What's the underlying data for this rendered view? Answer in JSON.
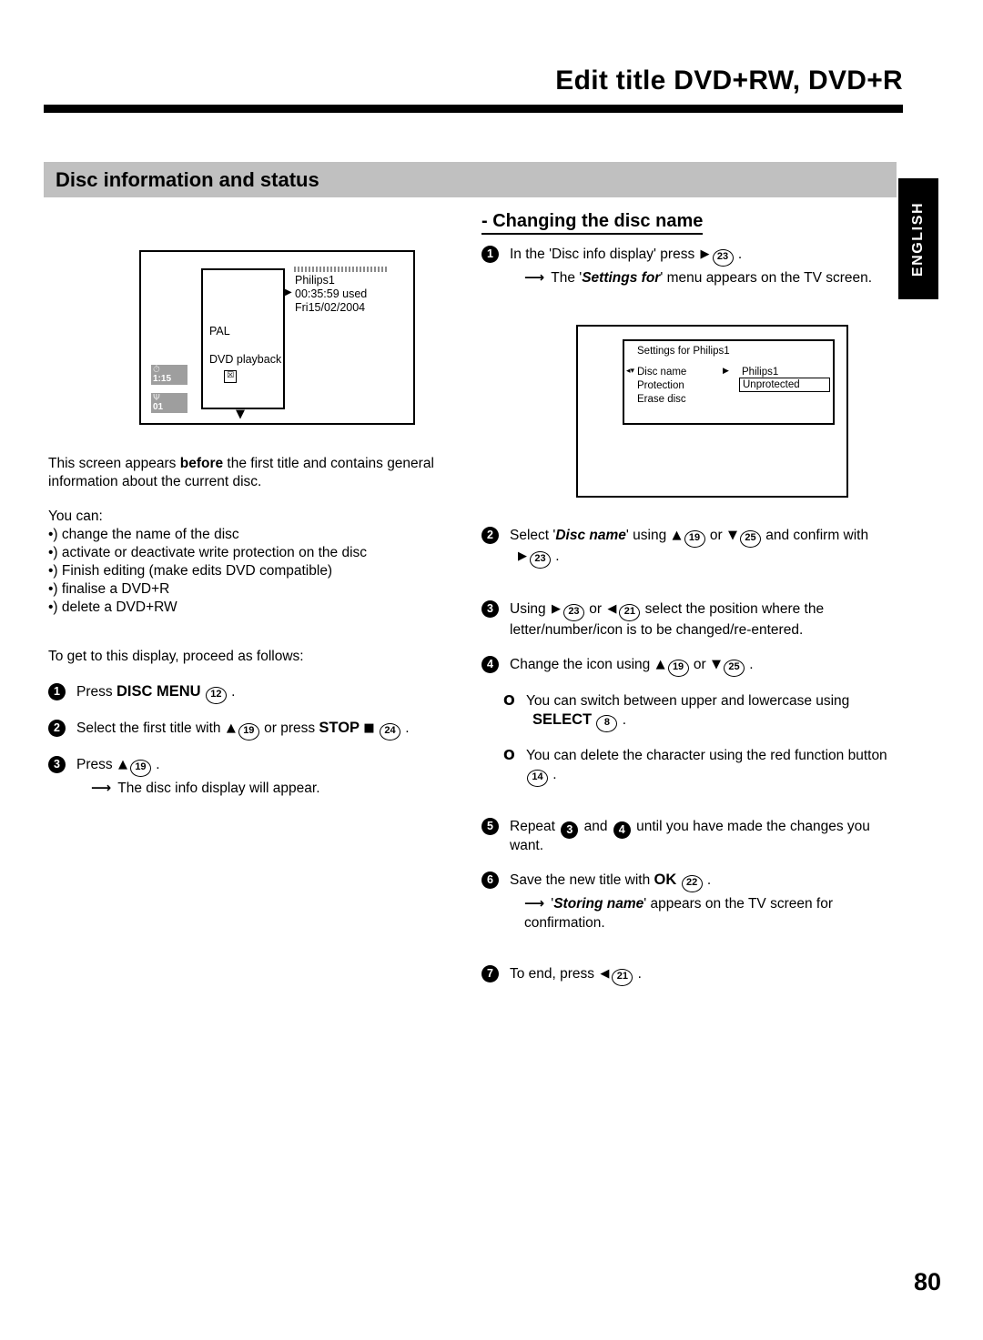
{
  "header": {
    "title": "Edit title DVD+RW, DVD+R"
  },
  "section": {
    "title": "Disc information and status"
  },
  "language_tab": {
    "label": "ENGLISH"
  },
  "left_screen": {
    "disc_name": "Philips1",
    "used_time": "00:35:59 used",
    "date": "Fri15/02/2004",
    "video_system": "PAL",
    "playback_mode": "DVD playback",
    "no_play_icon": "no-playback-icon",
    "badge_time_icon": "clock-icon",
    "badge_time_value": "1:15",
    "badge_tuner_icon": "antenna-icon",
    "badge_tuner_value": "01",
    "cursor_right_glyph": "▶",
    "down_caret_glyph": "▼",
    "no_play_glyph": "☒"
  },
  "left_column": {
    "intro_part1": "This screen appears ",
    "intro_bold": "before",
    "intro_part2": " the first title and contains general information about the current disc.",
    "you_can_label": "You can:",
    "capabilities": [
      "•) change the name of the disc",
      "•) activate or deactivate write protection on the disc",
      "•) Finish editing (make edits DVD compatible)",
      "•) finalise a DVD+R",
      "•) delete a DVD+RW"
    ],
    "howto_intro": "To get to this display, proceed as follows:",
    "steps": [
      {
        "num": "1",
        "pre": "Press ",
        "button": "DISC MENU",
        "keyref": "12",
        "post": " ."
      },
      {
        "num": "2",
        "pre": "Select the first title with ",
        "dir1": "▲",
        "keyref1": "19",
        "mid": " or press ",
        "button": "STOP",
        "square": "■",
        "keyref2": "24",
        "post": " ."
      },
      {
        "num": "3",
        "pre": "Press ",
        "dir1": "▲",
        "keyref1": "19",
        "post": " .",
        "result": "The disc info display will appear."
      }
    ]
  },
  "right_column": {
    "subheading": "- Changing the disc name",
    "step1": {
      "num": "1",
      "pre": "In the 'Disc info display' press ",
      "dir": "▶",
      "keyref": "23",
      "post": " .",
      "result_pre": "The '",
      "result_em": "Settings for",
      "result_post": "' menu appears on the TV screen."
    },
    "screen": {
      "title": "Settings for Philips1",
      "row1_label": "Disc name",
      "row1_value": "Philips1",
      "row2_label": "Protection",
      "row2_value": "Unprotected",
      "row3_label": "Erase disc",
      "cursor_left_glyph": "◂▾",
      "cursor_right_glyph": "▶"
    },
    "step2": {
      "num": "2",
      "pre": "Select '",
      "em": "Disc name",
      "mid1": "' using ",
      "dir1": "▲",
      "keyref1": "19",
      "mid2": " or ",
      "dir2": "▼",
      "keyref2": "25",
      "mid3": " and confirm with ",
      "dir3": "▶",
      "keyref3": "23",
      "post": " ."
    },
    "step3": {
      "num": "3",
      "pre": "Using ",
      "dir1": "▶",
      "keyref1": "23",
      "mid": " or ",
      "dir2": "◀",
      "keyref2": "21",
      "post": " select the position where the letter/number/icon is to be changed/re-entered."
    },
    "step4": {
      "num": "4",
      "pre": "Change the icon using ",
      "dir1": "▲",
      "keyref1": "19",
      "mid": " or ",
      "dir2": "▼",
      "keyref2": "25",
      "post": " ."
    },
    "note1": {
      "mark": "O",
      "text": "You can switch between upper and lowercase using",
      "button": "SELECT",
      "keyref": "8",
      "post": " ."
    },
    "note2": {
      "mark": "O",
      "text": "You can delete the character using the red function button",
      "keyref": "14",
      "post": " ."
    },
    "step5": {
      "num": "5",
      "pre": "Repeat ",
      "ref1": "3",
      "mid": " and ",
      "ref2": "4",
      "post": " until you have made the changes you want."
    },
    "step6": {
      "num": "6",
      "pre": "Save the new title with ",
      "button": "OK",
      "keyref": "22",
      "post": " .",
      "result_pre": "'",
      "result_em": "Storing name",
      "result_post": "' appears on the TV screen for confirmation."
    },
    "step7": {
      "num": "7",
      "pre": "To end, press ",
      "dir": "◀",
      "keyref": "21",
      "post": " ."
    }
  },
  "footer": {
    "page_number": "80"
  }
}
